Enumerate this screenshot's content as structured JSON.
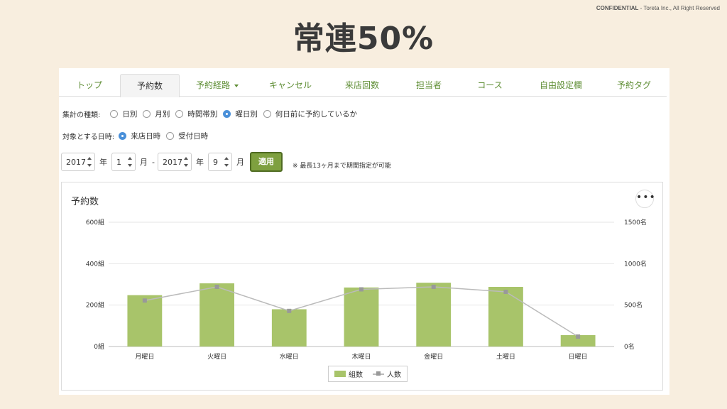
{
  "header": {
    "confidential_bold": "CONFIDENTIAL",
    "confidential_rest": " - Toreta Inc., All Right Reserved",
    "title": "常連50%"
  },
  "tabs": [
    {
      "label": "トップ",
      "active": false
    },
    {
      "label": "予約数",
      "active": true
    },
    {
      "label": "予約経路",
      "active": false,
      "dropdown": true
    },
    {
      "label": "キャンセル",
      "active": false
    },
    {
      "label": "来店回数",
      "active": false
    },
    {
      "label": "担当者",
      "active": false
    },
    {
      "label": "コース",
      "active": false
    },
    {
      "label": "自由設定欄",
      "active": false
    },
    {
      "label": "予約タグ",
      "active": false
    }
  ],
  "aggregation": {
    "label": "集計の種類:",
    "options": [
      "日別",
      "月別",
      "時間帯別",
      "曜日別",
      "何日前に予約しているか"
    ],
    "selected": "曜日別"
  },
  "target_date": {
    "label": "対象とする日時:",
    "options": [
      "来店日時",
      "受付日時"
    ],
    "selected": "来店日時"
  },
  "date_range": {
    "from_year": "2017",
    "from_month": "1",
    "to_year": "2017",
    "to_month": "9",
    "year_unit": "年",
    "month_unit": "月",
    "separator": "-",
    "apply_label": "適用",
    "note": "※ 最長13ヶ月まで期間指定が可能"
  },
  "chart_card": {
    "title": "予約数",
    "menu_icon": "more-horizontal-icon",
    "menu_glyph": "•••"
  },
  "chart_data": {
    "type": "bar",
    "categories": [
      "月曜日",
      "火曜日",
      "水曜日",
      "木曜日",
      "金曜日",
      "土曜日",
      "日曜日"
    ],
    "series": [
      {
        "name": "組数",
        "type": "bar",
        "axis": "left",
        "color": "#a8c46a",
        "values": [
          248,
          305,
          180,
          285,
          308,
          288,
          55
        ]
      },
      {
        "name": "人数",
        "type": "line",
        "axis": "right",
        "color": "#bbbbbb",
        "marker_color": "#999999",
        "values": [
          555,
          720,
          430,
          690,
          720,
          660,
          120
        ]
      }
    ],
    "left_axis": {
      "ticks": [
        "0組",
        "200組",
        "400組",
        "600組"
      ],
      "ylim": [
        0,
        600
      ]
    },
    "right_axis": {
      "ticks": [
        "0名",
        "500名",
        "1000名",
        "1500名"
      ],
      "ylim": [
        0,
        1500
      ]
    },
    "grid": true,
    "legend": "bottom-center"
  }
}
